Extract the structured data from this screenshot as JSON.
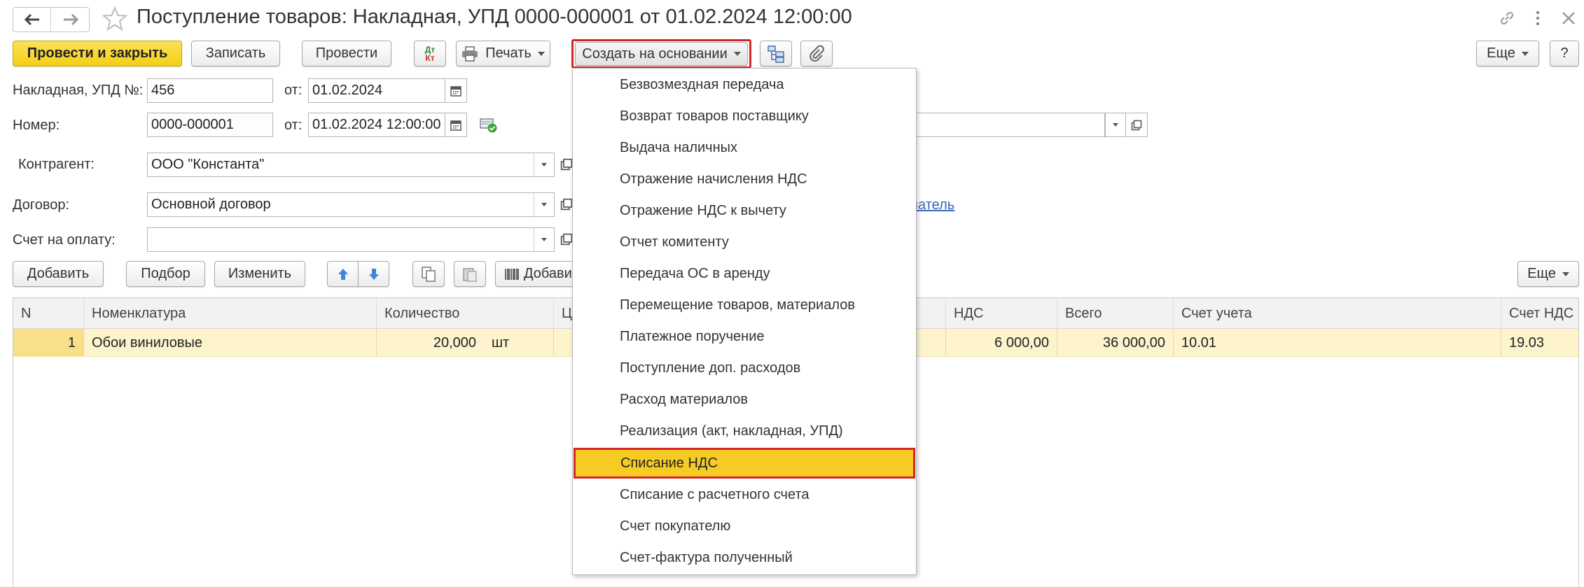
{
  "window": {
    "title": "Поступление товаров: Накладная, УПД 0000-000001 от 01.02.2024 12:00:00"
  },
  "toolbar": {
    "post_close": "Провести и закрыть",
    "save": "Записать",
    "post": "Провести",
    "dt_label": "Дт",
    "kt_label": "Кт",
    "print": "Печать",
    "create_based": "Создать на основании",
    "more": "Еще",
    "help": "?"
  },
  "form": {
    "invoice_label": "Накладная, УПД №:",
    "invoice_value": "456",
    "from_label": "от:",
    "invoice_date": "01.02.2024",
    "number_label": "Номер:",
    "number_value": "0000-000001",
    "number_datetime": "01.02.2024 12:00:00",
    "counterparty_label": "Контрагент:",
    "counterparty_value": "ООО \"Константа\"",
    "contract_label": "Договор:",
    "contract_value": "Основной договор",
    "contract_link_tail": "натель",
    "payment_label": "Счет на оплату:",
    "payment_value": ""
  },
  "table_toolbar": {
    "add": "Добавить",
    "select": "Подбор",
    "change": "Изменить",
    "add_barcode_partial": "Добави",
    "more": "Еще"
  },
  "table": {
    "headers": [
      "N",
      "Номенклатура",
      "Количество",
      "Ц",
      "НДС",
      "Всего",
      "Счет учета",
      "Счет НДС"
    ],
    "row": {
      "n": "1",
      "item": "Обои виниловые",
      "qty": "20,000",
      "unit": "шт",
      "vat": "6 000,00",
      "total": "36 000,00",
      "account": "10.01",
      "vat_account": "19.03"
    }
  },
  "menu": {
    "items": [
      "Безвозмездная передача",
      "Возврат товаров поставщику",
      "Выдача наличных",
      "Отражение начисления НДС",
      "Отражение НДС к вычету",
      "Отчет комитенту",
      "Передача ОС в аренду",
      "Перемещение товаров, материалов",
      "Платежное поручение",
      "Поступление доп. расходов",
      "Расход материалов",
      "Реализация (акт, накладная, УПД)",
      "Списание НДС",
      "Списание с расчетного счета",
      "Счет покупателю",
      "Счет-фактура полученный"
    ],
    "highlighted_index": 12
  },
  "colors": {
    "accent_yellow": "#f6cc24",
    "highlight_border": "#d42626",
    "row_selected": "#fdf3cd"
  }
}
